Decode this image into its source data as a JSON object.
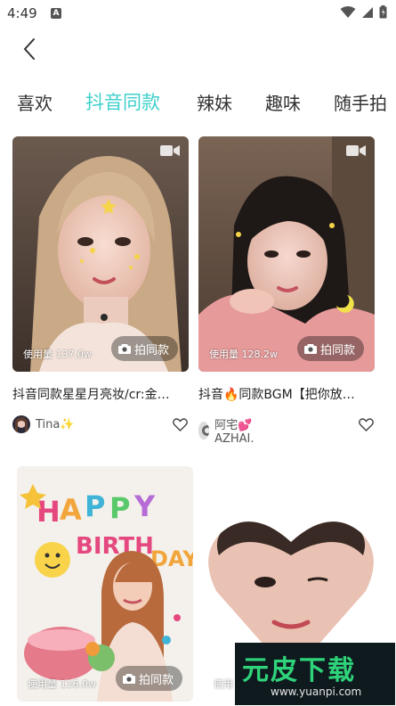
{
  "status_bar": {
    "time": "4:49",
    "notif_icon": "A"
  },
  "header": {
    "back_icon": "chevron-left-icon"
  },
  "tabs": [
    {
      "label": "喜欢",
      "active": false
    },
    {
      "label": "抖音同款",
      "active": true
    },
    {
      "label": "辣妹",
      "active": false
    },
    {
      "label": "趣味",
      "active": false
    },
    {
      "label": "随手拍",
      "active": false
    }
  ],
  "cards": [
    {
      "usage": "使用量 137.0w",
      "shoot_label": "拍同款",
      "title": "抖音同款星星月亮妆/cr:金…",
      "author": "Tina✨"
    },
    {
      "usage": "使用量 128.2w",
      "shoot_label": "拍同款",
      "title": "抖音🔥同款BGM【把你放…",
      "author": "阿宅💕AZHAI."
    },
    {
      "usage": "使用量 116.0w",
      "shoot_label": "拍同款",
      "title": "",
      "author": ""
    },
    {
      "usage": "使用",
      "shoot_label": "",
      "title": "",
      "author": ""
    }
  ],
  "watermark": {
    "main": "元皮下载",
    "sub": "www.yuanpi.com"
  },
  "colors": {
    "accent": "#3ed0cc"
  }
}
